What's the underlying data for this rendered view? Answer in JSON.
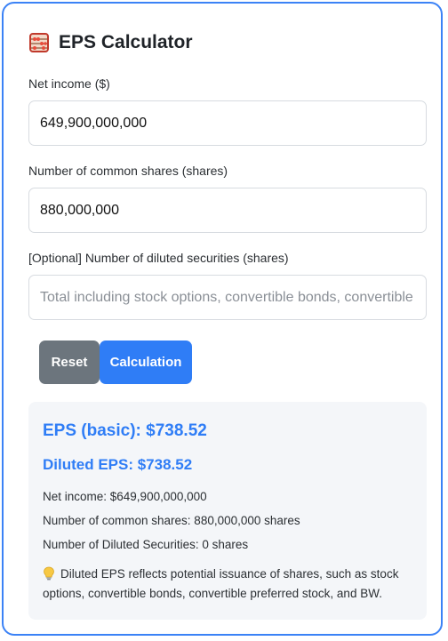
{
  "app": {
    "title": "EPS Calculator",
    "icon": "abacus-icon"
  },
  "form": {
    "net_income": {
      "label": "Net income ($)",
      "value": "649,900,000,000"
    },
    "common_shares": {
      "label": "Number of common shares (shares)",
      "value": "880,000,000"
    },
    "diluted_securities": {
      "label": "[Optional] Number of diluted securities (shares)",
      "value": "",
      "placeholder": "Total including stock options, convertible bonds, convertible preferred stock, and BW"
    }
  },
  "buttons": {
    "reset_label": "Reset",
    "calc_label": "Calculation"
  },
  "result": {
    "basic_eps": "EPS (basic): $738.52",
    "diluted_eps": "Diluted EPS: $738.52",
    "net_income_line": "Net income: $649,900,000,000",
    "common_shares_line": "Number of common shares: 880,000,000 shares",
    "diluted_securities_line": "Number of Diluted Securities: 0 shares",
    "note_icon": "lightbulb-icon",
    "note": "Diluted EPS reflects potential issuance of shares, such as stock options, convertible bonds, convertible preferred stock, and BW."
  },
  "colors": {
    "accent": "#2f7df6",
    "card_border": "#3b82f6",
    "reset_button": "#6c757d",
    "result_background": "#f4f6f9"
  }
}
